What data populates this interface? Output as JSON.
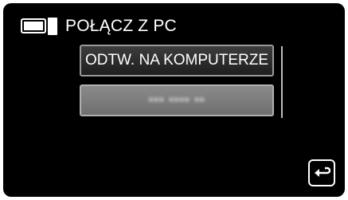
{
  "header": {
    "title": "POŁĄCZ Z PC",
    "icon": "pc-monitor-icon"
  },
  "menu": {
    "items": [
      {
        "label": "ODTW. NA KOMPUTERZE"
      },
      {
        "label": "▪▪▪ ▪▪▪▪ ▪▪"
      }
    ]
  },
  "controls": {
    "back_icon": "return-arrow-icon"
  },
  "colors": {
    "background": "#000000",
    "button_border": "#9a9a9a",
    "selected_button": "#7a7a7a",
    "text": "#ffffff"
  }
}
